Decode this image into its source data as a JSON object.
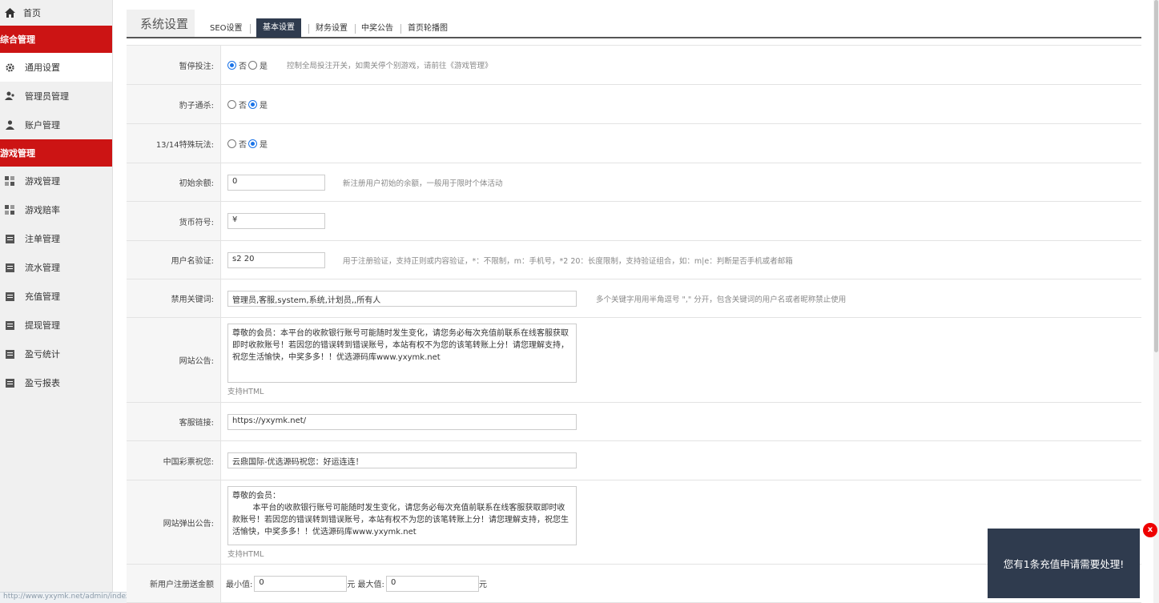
{
  "sidebar": {
    "home": "首页",
    "section1": "综合管理",
    "section2": "游戏管理",
    "items1": [
      "通用设置",
      "管理员管理",
      "账户管理"
    ],
    "items2": [
      "游戏管理",
      "游戏赔率",
      "注单管理",
      "流水管理",
      "充值管理",
      "提现管理",
      "盈亏统计",
      "盈亏报表"
    ],
    "status_url": "http://www.yxymk.net/admin/index.html"
  },
  "tabs": {
    "title": "系统设置",
    "items": [
      "SEO设置",
      "基本设置",
      "财务设置",
      "中奖公告",
      "首页轮播图"
    ],
    "active": "基本设置"
  },
  "form": {
    "pause": {
      "label": "暂停投注:",
      "opt_no": "否",
      "opt_yes": "是",
      "selected": "否",
      "hint": "控制全局投注开关，如需关停个别游戏，请前往《游戏管理》"
    },
    "leopard": {
      "label": "豹子通杀:",
      "opt_no": "否",
      "opt_yes": "是",
      "selected": "是"
    },
    "special": {
      "label": "13/14特殊玩法:",
      "opt_no": "否",
      "opt_yes": "是",
      "selected": "是"
    },
    "initial_balance": {
      "label": "初始余额:",
      "value": "0",
      "hint": "新注册用户初始的余额，一般用于限时个体活动"
    },
    "currency": {
      "label": "货币符号:",
      "value": "¥"
    },
    "username_check": {
      "label": "用户名验证:",
      "value": "s2 20",
      "hint": "用于注册验证，支持正则或内容验证，*：不限制，m：手机号，*2 20：长度限制，支持验证组合，如：m|e：判断是否手机或者邮箱"
    },
    "banned_words": {
      "label": "禁用关键词:",
      "value": "管理员,客服,system,系统,计划员,,所有人",
      "hint": "多个关键字用用半角逗号 \",\" 分开，包含关键词的用户名或者昵称禁止使用"
    },
    "site_notice": {
      "label": "网站公告:",
      "value": "尊敬的会员：本平台的收款银行账号可能随时发生变化，请您务必每次充值前联系在线客服获取即时收款账号！若因您的错误转到错误账号，本站有权不为您的该笔转账上分！请您理解支持，祝您生活愉快，中奖多多！！优选源码库www.yxymk.net",
      "support": "支持HTML"
    },
    "service_link": {
      "label": "客服链接:",
      "value": "https://yxymk.net/"
    },
    "lottery_wish": {
      "label": "中国彩票祝您:",
      "value": "云鼎国际-优选源码祝您：好运连连！"
    },
    "popup_notice": {
      "label": "网站弹出公告:",
      "value": "尊敬的会员：\n        本平台的收款银行账号可能随时发生变化，请您务必每次充值前联系在线客服获取即时收款账号！若因您的错误转到错误账号，本站有权不为您的该笔转账上分！请您理解支持，祝您生活愉快，中奖多多！！优选源码库www.yxymk.net",
      "support": "支持HTML"
    },
    "new_user_bonus": {
      "label": "新用户注册送金额",
      "min_label": "最小值:",
      "min_value": "0",
      "max_label": "元 最大值:",
      "max_value": "0",
      "unit": "元"
    }
  },
  "toast": {
    "message": "您有1条充值申请需要处理!",
    "close": "x"
  },
  "colors": {
    "sidebar_section": "#cc1414",
    "tab_active": "#2f3b4e",
    "radio": "#1a73e8",
    "toast_bg": "#2f3b4e",
    "toast_close": "#ee0000"
  }
}
